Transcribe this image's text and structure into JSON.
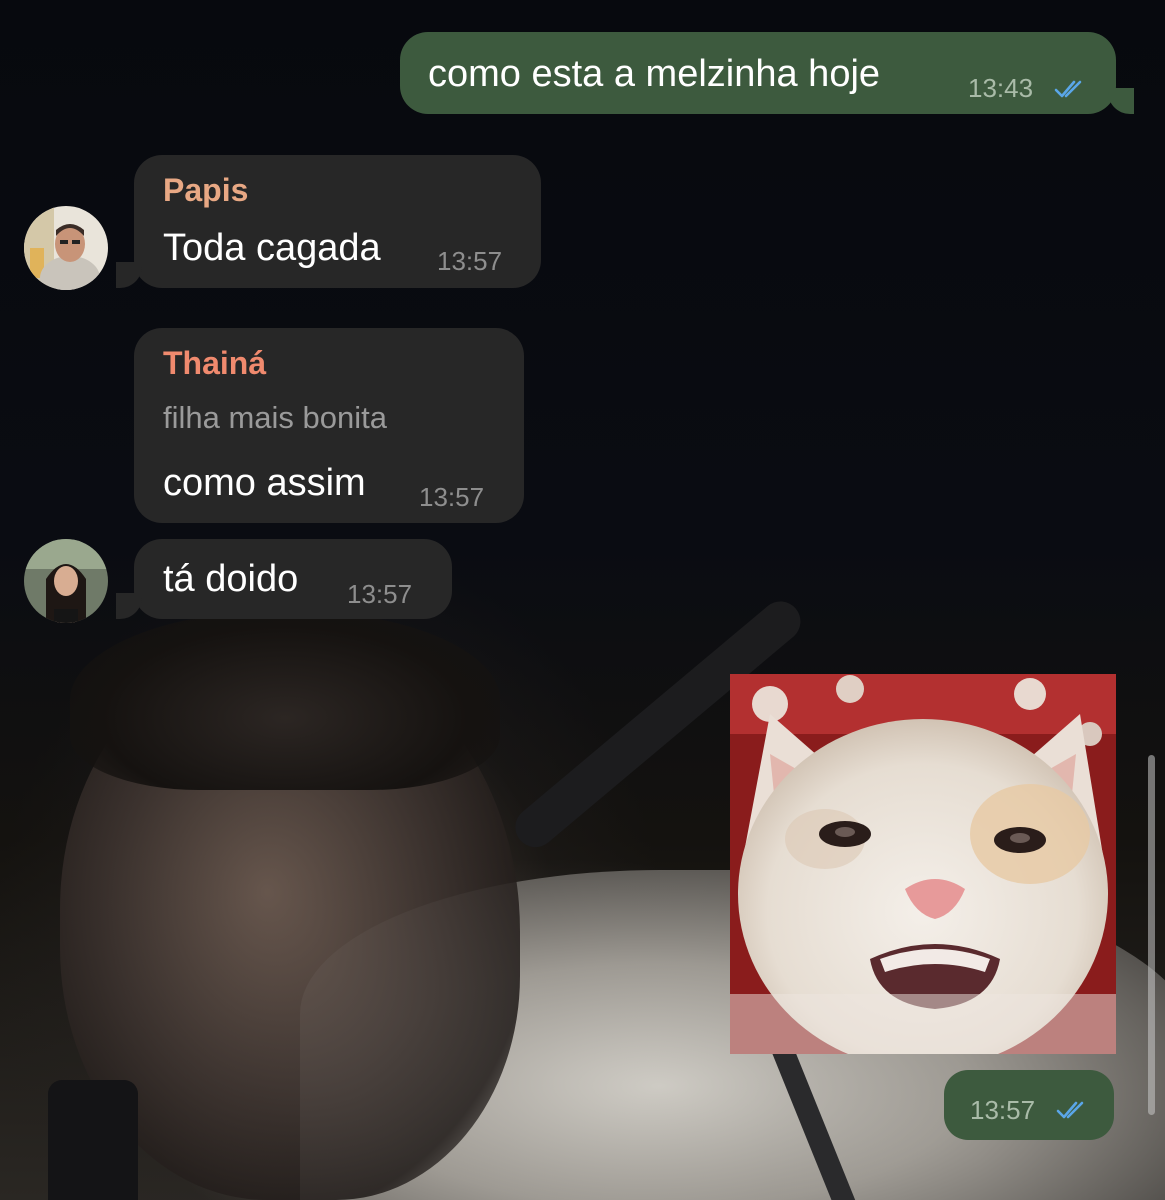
{
  "messages": [
    {
      "id": "m1",
      "direction": "outgoing",
      "text": "como esta a melzinha hoje",
      "time": "13:43",
      "status": "read"
    },
    {
      "id": "m2",
      "direction": "incoming",
      "sender": "Papis",
      "text": "Toda cagada",
      "time": "13:57"
    },
    {
      "id": "m3",
      "direction": "incoming",
      "sender": "Thainá",
      "reply_to": "filha mais bonita",
      "text": "como assim",
      "time": "13:57"
    },
    {
      "id": "m4",
      "direction": "incoming",
      "text": "tá doido",
      "time": "13:57"
    },
    {
      "id": "m5",
      "direction": "outgoing",
      "type": "sticker",
      "sticker": "crying-cat-sticker",
      "time": "13:57",
      "status": "read"
    }
  ],
  "colors": {
    "outgoing_bubble": "#3d5a3e",
    "incoming_bubble": "#272727",
    "sender_papis": "#e8a884",
    "sender_thaina": "#f08a6e",
    "read_check": "#5aa6e8"
  },
  "icons": {
    "read_receipt": "double-check-icon"
  }
}
